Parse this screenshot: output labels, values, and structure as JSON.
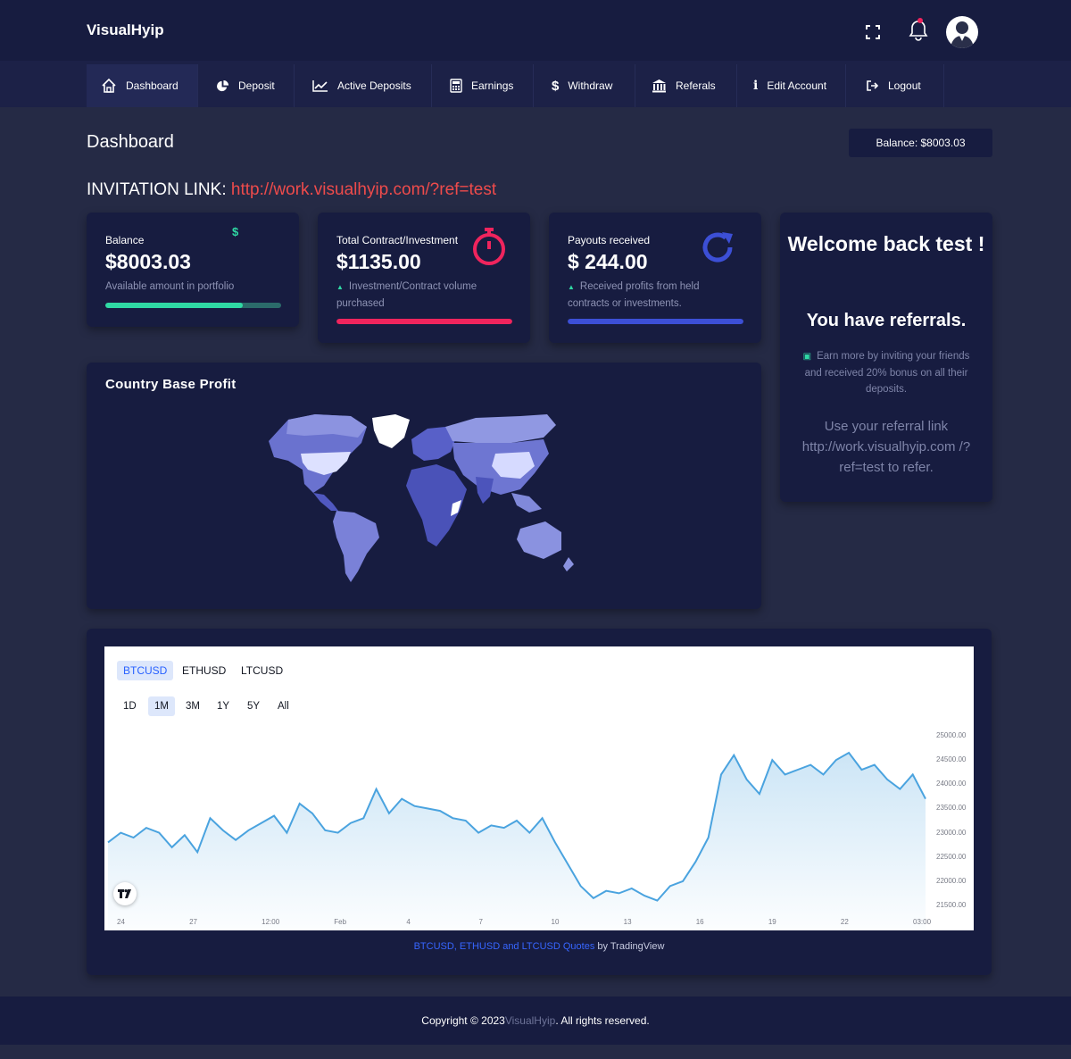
{
  "app": {
    "brand": "VisualHyip"
  },
  "nav": {
    "items": [
      {
        "label": "Dashboard",
        "icon": "home-icon"
      },
      {
        "label": "Deposit",
        "icon": "pie-chart-icon"
      },
      {
        "label": "Active Deposits",
        "icon": "line-chart-icon"
      },
      {
        "label": "Earnings",
        "icon": "calculator-icon"
      },
      {
        "label": "Withdraw",
        "icon": "dollar-icon"
      },
      {
        "label": "Referals",
        "icon": "bank-icon"
      },
      {
        "label": "Edit Account",
        "icon": "info-icon"
      },
      {
        "label": "Logout",
        "icon": "sign-out-icon"
      }
    ]
  },
  "page": {
    "title": "Dashboard",
    "balance_pill": "Balance: $8003.03",
    "invite_label": "INVITATION LINK:",
    "invite_url": "http://work.visualhyip.com/?ref=test"
  },
  "stats": [
    {
      "label": "Balance",
      "value": "$8003.03",
      "desc": "Available amount in portfolio",
      "progress": 0.78,
      "color": "#2fd9a4",
      "track": "#2b6b6a",
      "icon": "dollar-icon"
    },
    {
      "label": "Total Contract/Investment",
      "value": "$1135.00",
      "desc": "Investment/Contract volume purchased",
      "progress": 1.0,
      "color": "#f0245d",
      "track": "#f0245d",
      "icon": "stopwatch-icon"
    },
    {
      "label": "Payouts received",
      "value": "$ 244.00",
      "desc": "Received profits from held contracts or investments.",
      "progress": 1.0,
      "color": "#3c4fd6",
      "track": "#3c4fd6",
      "icon": "refresh-icon"
    }
  ],
  "welcome": {
    "title": "Welcome back test !",
    "referrals": "You have referrals.",
    "earn": "Earn more by inviting your friends and received 20% bonus on all their deposits.",
    "use": "Use your referral link http://work.visualhyip.com /?ref=test to refer."
  },
  "map": {
    "title": "Country Base Profit"
  },
  "chart": {
    "symbols": [
      "BTCUSD",
      "ETHUSD",
      "LTCUSD"
    ],
    "active_symbol": "BTCUSD",
    "ranges": [
      "1D",
      "1M",
      "3M",
      "1Y",
      "5Y",
      "All"
    ],
    "active_range": "1M",
    "caption_links": "BTCUSD, ETHUSD and LTCUSD Quotes",
    "caption_by": " by TradingView",
    "line_color": "#4aa3df"
  },
  "chart_data": {
    "type": "area",
    "title": "",
    "series": [
      {
        "values": [
          22800,
          23000,
          22900,
          23100,
          23000,
          22700,
          22950,
          22600,
          23300,
          23050,
          22850,
          23050,
          23200,
          23350,
          23000,
          23600,
          23400,
          23050,
          23000,
          23200,
          23300,
          23900,
          23400,
          23700,
          23550,
          23500,
          23450,
          23300,
          23250,
          23000,
          23150,
          23100,
          23250,
          23000,
          23300,
          22800,
          22350,
          21900,
          21650,
          21800,
          21750,
          21850,
          21700,
          21600,
          21900,
          22000,
          22400,
          22900,
          24200,
          24600,
          24100,
          23800,
          24500,
          24200,
          24300,
          24400,
          24200,
          24500,
          24650,
          24300,
          24400,
          24100,
          23900,
          24200,
          23700
        ]
      }
    ],
    "x_tick_labels": [
      "24",
      "27",
      "12:00",
      "Feb",
      "4",
      "7",
      "10",
      "13",
      "16",
      "19",
      "22",
      "03:00"
    ],
    "y_tick_labels": [
      "25000.00",
      "24500.00",
      "24000.00",
      "23500.00",
      "23000.00",
      "22500.00",
      "22000.00",
      "21500.00"
    ],
    "ylim": [
      21500,
      25000
    ],
    "grid": false
  },
  "footer": {
    "prefix": "Copyright © 2023 ",
    "brand": "VisualHyip",
    "suffix": ". All rights reserved."
  }
}
